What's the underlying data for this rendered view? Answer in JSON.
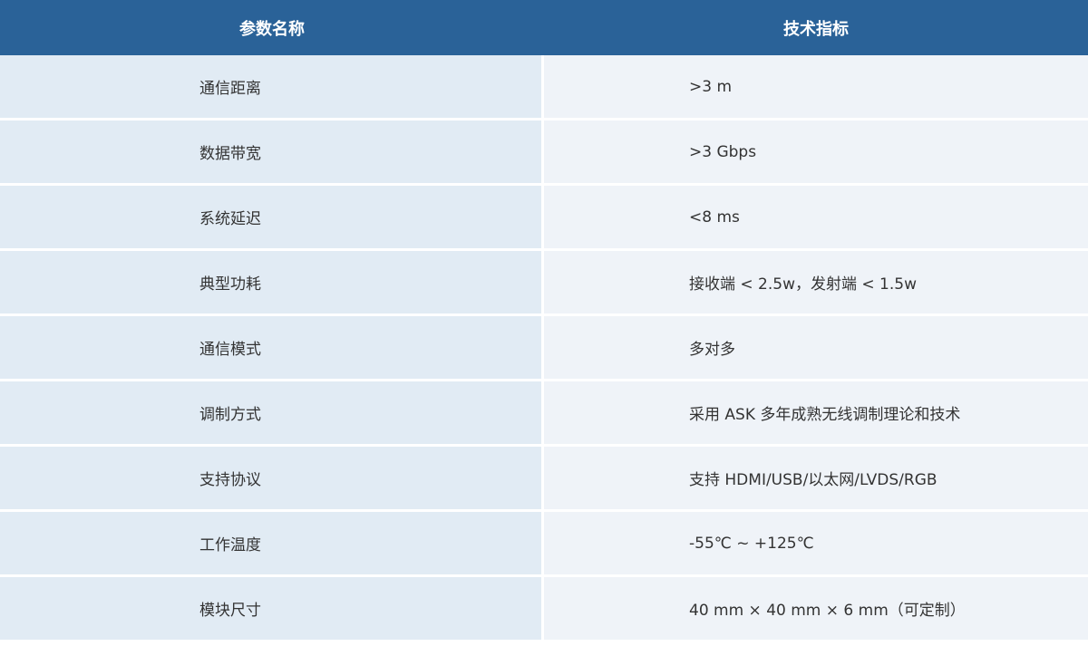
{
  "table": {
    "headers": [
      "参数名称",
      "技术指标"
    ],
    "rows": [
      {
        "name": "通信距离",
        "value": ">3 m"
      },
      {
        "name": "数据带宽",
        "value": ">3 Gbps"
      },
      {
        "name": "系统延迟",
        "value": "<8 ms"
      },
      {
        "name": "典型功耗",
        "value": "接收端 < 2.5w，发射端 < 1.5w"
      },
      {
        "name": "通信模式",
        "value": "多对多"
      },
      {
        "name": "调制方式",
        "value": "采用 ASK 多年成熟无线调制理论和技术"
      },
      {
        "name": "支持协议",
        "value": "支持 HDMI/USB/以太网/LVDS/RGB"
      },
      {
        "name": "工作温度",
        "value": "-55℃ ~ +125℃"
      },
      {
        "name": "模块尺寸",
        "value": "40 mm × 40 mm × 6 mm（可定制）"
      }
    ]
  },
  "colors": {
    "header_bg": "#2a6298",
    "name_cell_bg": "#e1ebf4",
    "value_cell_bg": "#eff3f8"
  }
}
